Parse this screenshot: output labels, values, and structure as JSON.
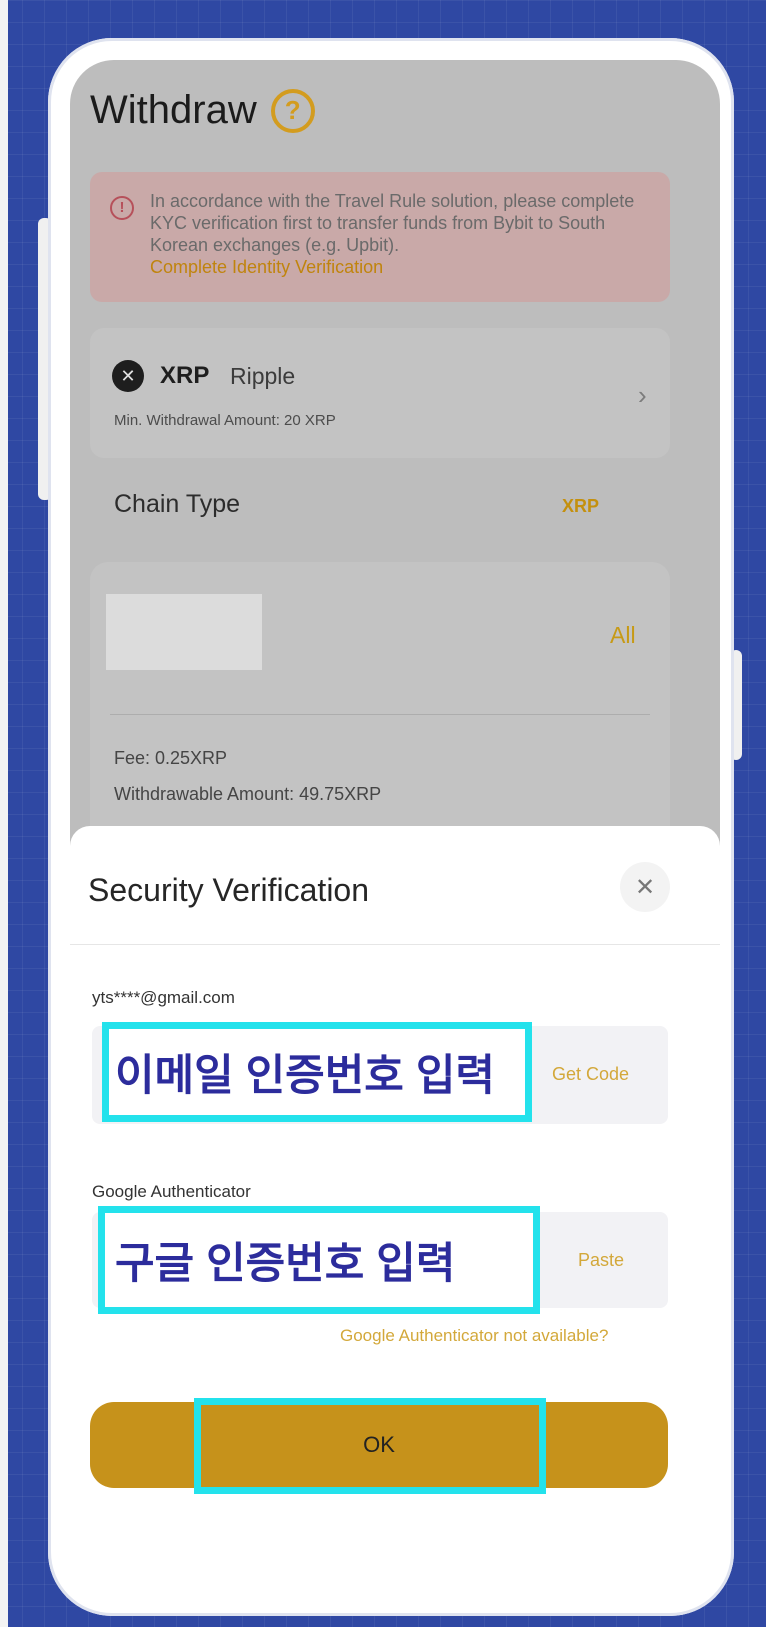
{
  "header": {
    "title": "Withdraw"
  },
  "notice": {
    "text": "In accordance with the Travel Rule solution, please complete KYC verification first to transfer funds from Bybit to South Korean exchanges (e.g. Upbit).",
    "link": "Complete Identity Verification"
  },
  "coin": {
    "symbol": "XRP",
    "name": "Ripple",
    "min_withdrawal": "Min. Withdrawal Amount: 20 XRP"
  },
  "chain": {
    "label": "Chain Type",
    "value": "XRP"
  },
  "amount": {
    "all_label": "All",
    "fee": "Fee: 0.25XRP",
    "withdrawable": "Withdrawable Amount: 49.75XRP"
  },
  "security": {
    "title": "Security Verification",
    "email_label": "yts****@gmail.com",
    "email_overlay": "이메일 인증번호 입력",
    "get_code": "Get Code",
    "ga_label": "Google Authenticator",
    "ga_overlay": "구글 인증번호 입력",
    "paste": "Paste",
    "ga_help": "Google Authenticator not available?",
    "ok": "OK"
  },
  "colors": {
    "accent": "#c6921b",
    "highlight": "#23e2ec",
    "overlay_text": "#2c2c9c"
  },
  "icons": {
    "help": "help-icon",
    "alert": "alert-icon",
    "coin": "xrp-coin-icon",
    "chevron": "chevron-right-icon",
    "close": "close-icon"
  }
}
